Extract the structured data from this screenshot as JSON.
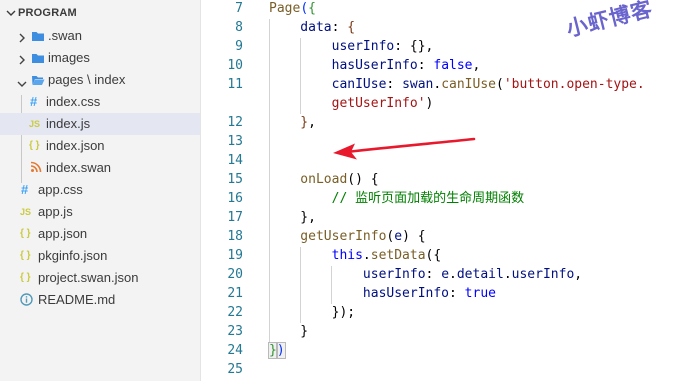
{
  "explorer": {
    "section_title": "PROGRAM",
    "items": [
      {
        "label": ".swan",
        "kind": "folder",
        "expanded": false
      },
      {
        "label": "images",
        "kind": "folder",
        "expanded": false
      },
      {
        "label": "pages \\ index",
        "kind": "folder-open",
        "expanded": true
      },
      {
        "label": "index.css",
        "kind": "css",
        "icon_text": "#"
      },
      {
        "label": "index.js",
        "kind": "js",
        "icon_text": "JS",
        "selected": true
      },
      {
        "label": "index.json",
        "kind": "json",
        "icon_text": "{ }"
      },
      {
        "label": "index.swan",
        "kind": "swan"
      },
      {
        "label": "app.css",
        "kind": "css",
        "icon_text": "#"
      },
      {
        "label": "app.js",
        "kind": "js",
        "icon_text": "JS"
      },
      {
        "label": "app.json",
        "kind": "json",
        "icon_text": "{ }"
      },
      {
        "label": "pkginfo.json",
        "kind": "json",
        "icon_text": "{ }"
      },
      {
        "label": "project.swan.json",
        "kind": "json",
        "icon_text": "{ }"
      },
      {
        "label": "README.md",
        "kind": "info"
      }
    ]
  },
  "editor": {
    "line_numbers": [
      "7",
      "8",
      "9",
      "10",
      "11",
      "",
      "12",
      "13",
      "14",
      "15",
      "16",
      "17",
      "18",
      "19",
      "20",
      "21",
      "22",
      "23",
      "24",
      "25"
    ],
    "lines": [
      {
        "seg": [
          [
            "fn",
            "Page"
          ],
          [
            "brk",
            "("
          ],
          [
            "brk2",
            "{"
          ]
        ]
      },
      {
        "seg": [
          [
            "prop",
            "    data"
          ],
          [
            "plain",
            ": "
          ],
          [
            "brk3",
            "{"
          ]
        ]
      },
      {
        "seg": [
          [
            "prop",
            "        userInfo"
          ],
          [
            "plain",
            ": {},"
          ]
        ]
      },
      {
        "seg": [
          [
            "prop",
            "        hasUserInfo"
          ],
          [
            "plain",
            ": "
          ],
          [
            "kw",
            "false"
          ],
          [
            "plain",
            ","
          ]
        ]
      },
      {
        "seg": [
          [
            "prop",
            "        canIUse"
          ],
          [
            "plain",
            ": "
          ],
          [
            "prop",
            "swan"
          ],
          [
            "plain",
            "."
          ],
          [
            "fn",
            "canIUse"
          ],
          [
            "plain",
            "("
          ],
          [
            "str",
            "'button.open-type."
          ]
        ]
      },
      {
        "seg": [
          [
            "str",
            "        getUserInfo'"
          ],
          [
            "plain",
            ")"
          ]
        ]
      },
      {
        "seg": [
          [
            "brk3",
            "    }"
          ],
          [
            "plain",
            ","
          ]
        ]
      },
      {
        "seg": []
      },
      {
        "seg": []
      },
      {
        "seg": [
          [
            "fn",
            "    onLoad"
          ],
          [
            "plain",
            "() {"
          ]
        ]
      },
      {
        "seg": [
          [
            "cmt",
            "        // 监听页面加载的生命周期函数"
          ]
        ]
      },
      {
        "seg": [
          [
            "plain",
            "    },"
          ]
        ]
      },
      {
        "seg": [
          [
            "fn",
            "    getUserInfo"
          ],
          [
            "plain",
            "("
          ],
          [
            "prop",
            "e"
          ],
          [
            "plain",
            ") {"
          ]
        ]
      },
      {
        "seg": [
          [
            "kw",
            "        this"
          ],
          [
            "plain",
            "."
          ],
          [
            "fn",
            "setData"
          ],
          [
            "plain",
            "({"
          ]
        ]
      },
      {
        "seg": [
          [
            "prop",
            "            userInfo"
          ],
          [
            "plain",
            ": "
          ],
          [
            "prop",
            "e"
          ],
          [
            "plain",
            "."
          ],
          [
            "prop",
            "detail"
          ],
          [
            "plain",
            "."
          ],
          [
            "prop",
            "userInfo"
          ],
          [
            "plain",
            ","
          ]
        ]
      },
      {
        "seg": [
          [
            "prop",
            "            hasUserInfo"
          ],
          [
            "plain",
            ": "
          ],
          [
            "kw",
            "true"
          ]
        ]
      },
      {
        "seg": [
          [
            "plain",
            "        });"
          ]
        ]
      },
      {
        "seg": [
          [
            "plain",
            "    }"
          ]
        ]
      },
      {
        "seg": [
          [
            "brk2hl",
            "}"
          ],
          [
            "brkhl",
            ")"
          ]
        ]
      },
      {
        "seg": []
      }
    ]
  },
  "watermark": "小虾博客",
  "colors": {
    "folder_blue": "#3d8ee0",
    "css_blue": "#42a5f5",
    "js_yellow": "#cbcb41",
    "json_yellow": "#cbcb41",
    "swan_orange": "#e37933",
    "info_blue": "#519aba",
    "annotation_red": "#e8192c"
  }
}
